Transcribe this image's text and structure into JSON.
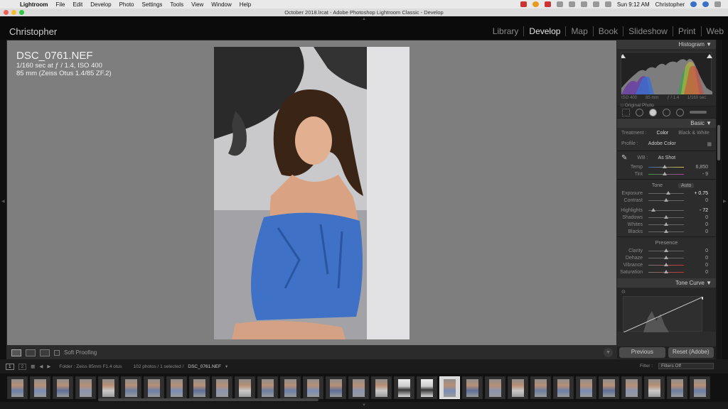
{
  "macos": {
    "apple_icon": "",
    "app_menu": [
      "Lightroom",
      "File",
      "Edit",
      "Develop",
      "Photo",
      "Settings",
      "Tools",
      "View",
      "Window",
      "Help"
    ],
    "status_icons": [
      "cloud-icon",
      "gamepad-icon",
      "calendar-icon",
      "airplay-icon",
      "history-icon",
      "bluetooth-icon",
      "wifi-icon",
      "volume-icon"
    ],
    "clock": "Sun 9:12 AM",
    "user": "Christopher"
  },
  "window": {
    "title": "October 2018.lrcat - Adobe Photoshop Lightroom Classic - Develop"
  },
  "lightroom": {
    "identity_plate": "Christopher",
    "modules": [
      "Library",
      "Develop",
      "Map",
      "Book",
      "Slideshow",
      "Print",
      "Web"
    ],
    "active_module": "Develop"
  },
  "photo_info": {
    "filename": "DSC_0761.NEF",
    "exposure_line": "1/160 sec at ƒ / 1.4, ISO 400",
    "lens_line": "85 mm (Zeiss Otus 1.4/85 ZF.2)"
  },
  "toolbar": {
    "soft_proofing": "Soft Proofing"
  },
  "histogram": {
    "title": "Histogram",
    "iso": "ISO 400",
    "focal": "85 mm",
    "aperture": "ƒ / 1.4",
    "shutter": "1/160 sec",
    "original_photo": "Original Photo"
  },
  "basic": {
    "title": "Basic",
    "treatment_label": "Treatment :",
    "treatment_color": "Color",
    "treatment_bw": "Black & White",
    "profile_label": "Profile :",
    "profile_value": "Adobe Color",
    "wb_label": "WB :",
    "wb_value": "As Shot",
    "temp_label": "Temp",
    "temp_value": "6,850",
    "temp_position": 0.45,
    "tint_label": "Tint",
    "tint_value": "- 9",
    "tint_position": 0.46,
    "tone_label": "Tone",
    "auto_label": "Auto",
    "exposure_label": "Exposure",
    "exposure_value": "+ 0.75",
    "exposure_position": 0.56,
    "contrast_label": "Contrast",
    "contrast_value": "0",
    "contrast_position": 0.5,
    "highlights_label": "Highlights",
    "highlights_value": "- 72",
    "highlights_position": 0.14,
    "shadows_label": "Shadows",
    "shadows_value": "0",
    "shadows_position": 0.5,
    "whites_label": "Whites",
    "whites_value": "0",
    "whites_position": 0.5,
    "blacks_label": "Blacks",
    "blacks_value": "0",
    "blacks_position": 0.5,
    "presence_label": "Presence",
    "clarity_label": "Clarity",
    "clarity_value": "0",
    "clarity_position": 0.5,
    "dehaze_label": "Dehaze",
    "dehaze_value": "0",
    "dehaze_position": 0.5,
    "vibrance_label": "Vibrance",
    "vibrance_value": "0",
    "vibrance_position": 0.5,
    "saturation_label": "Saturation",
    "saturation_value": "0",
    "saturation_position": 0.5
  },
  "tone_curve": {
    "title": "Tone Curve"
  },
  "buttons": {
    "previous": "Previous",
    "reset": "Reset (Adobe)"
  },
  "filmstrip": {
    "view1": "1",
    "view2": "2",
    "folder_text": "Folder : Zeiss 85mm F1.4 otus",
    "count_text": "102 photos / 1 selected /",
    "selected_file": "DSC_0761.NEF",
    "filter_label": "Filter :",
    "filter_value": "Filters Off",
    "thumbnail_count": 31,
    "selected_index": 19
  },
  "colors": {
    "accent_blue": "#3a6fc4",
    "panel_bg": "#2c2c2c",
    "canvas_bg": "#7e7e7e"
  }
}
